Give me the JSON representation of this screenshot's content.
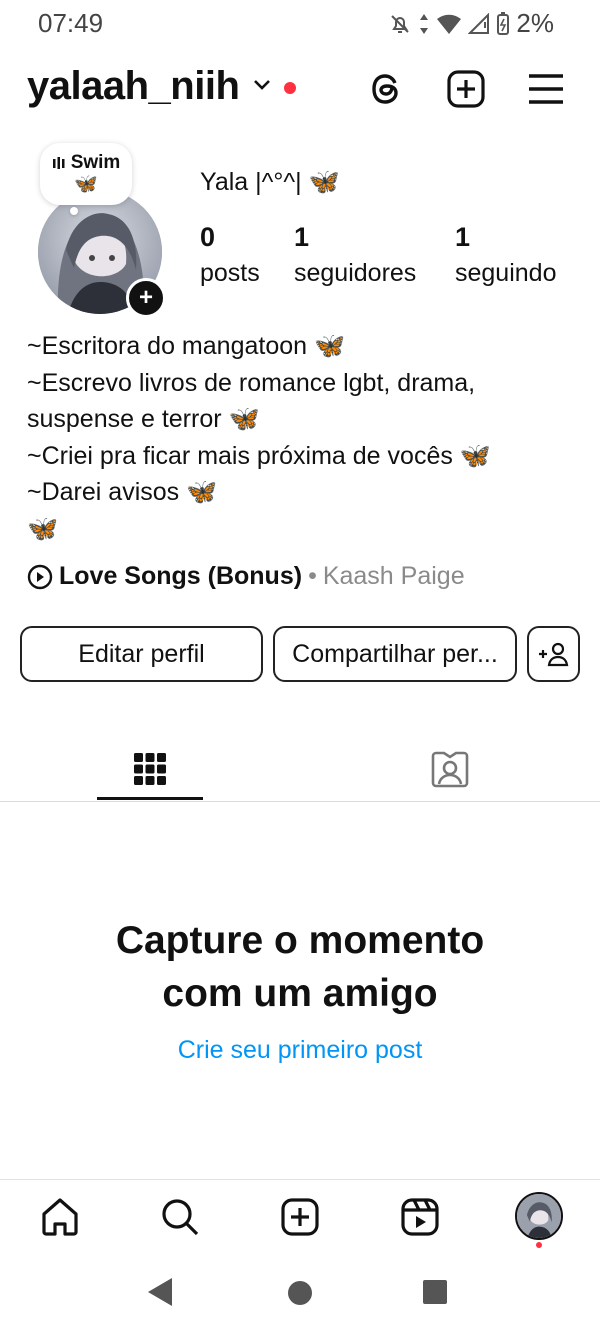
{
  "status_bar": {
    "time": "07:49",
    "battery": "2%"
  },
  "header": {
    "username": "yalaah_niih"
  },
  "note": {
    "label": "Swim",
    "emoji": "🦋"
  },
  "profile": {
    "display_name": "Yala |^°^| 🦋",
    "stats": [
      {
        "value": "0",
        "label": "posts"
      },
      {
        "value": "1",
        "label": "seguidores"
      },
      {
        "value": "1",
        "label": "seguindo"
      }
    ],
    "bio_lines": [
      "~Escritora do mangatoon 🦋",
      "~Escrevo livros de romance lgbt, drama,",
      "suspense e terror 🦋",
      "~Criei pra ficar mais próxima de vocês 🦋",
      "~Darei avisos 🦋",
      "🦋"
    ],
    "music": {
      "song": "Love Songs (Bonus)",
      "separator": "•",
      "artist": "Kaash Paige"
    }
  },
  "buttons": {
    "edit": "Editar perfil",
    "share": "Compartilhar per..."
  },
  "empty_state": {
    "title_line1": "Capture o momento",
    "title_line2": "com um amigo",
    "link": "Crie seu primeiro post"
  },
  "icons": {
    "status": [
      "mute-bell-icon",
      "data-arrows-icon",
      "wifi-icon",
      "signal-icon",
      "battery-icon"
    ],
    "header": [
      "threads-icon",
      "create-icon",
      "menu-icon"
    ],
    "tabs": [
      "grid-icon",
      "tagged-icon"
    ],
    "nav": [
      "home-icon",
      "search-icon",
      "create-icon",
      "reels-icon",
      "profile-avatar"
    ]
  },
  "colors": {
    "accent_link": "#0095f6",
    "notification_dot": "#ff3040"
  }
}
